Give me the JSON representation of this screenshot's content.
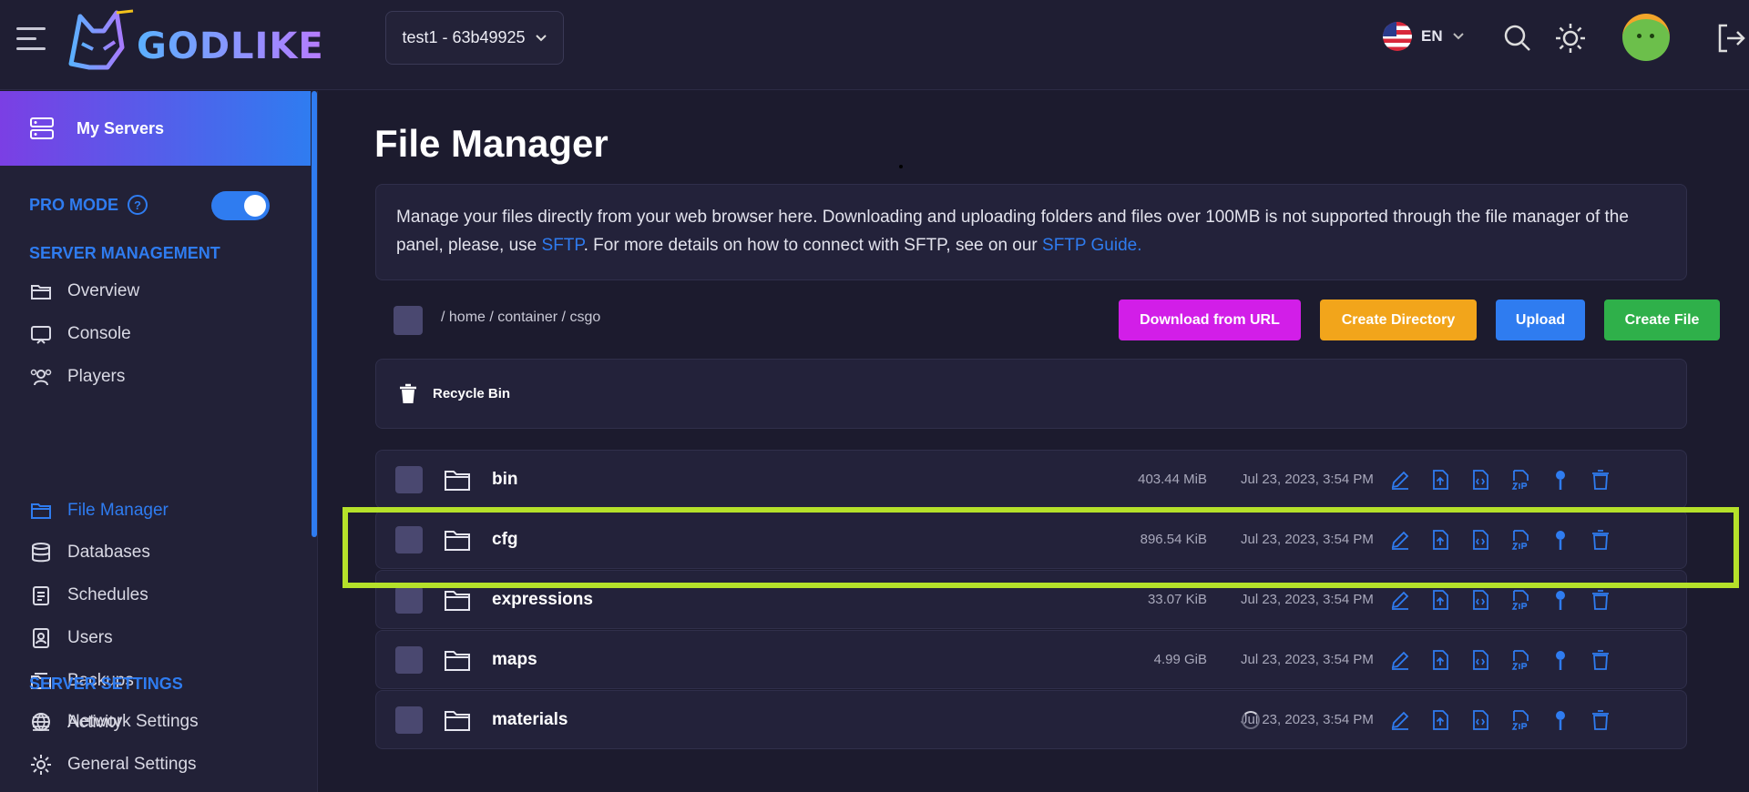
{
  "header": {
    "logo_text": "GODLIKE",
    "server_selector": "test1 - 63b49925",
    "language": "EN"
  },
  "sidebar": {
    "my_servers": "My Servers",
    "pro_mode_label": "PRO MODE",
    "pro_mode_enabled": true,
    "help_glyph": "?",
    "section_management": "SERVER MANAGEMENT",
    "management_items": [
      {
        "label": "Overview",
        "icon": "folder-open-icon"
      },
      {
        "label": "Console",
        "icon": "console-icon"
      },
      {
        "label": "Players",
        "icon": "players-icon"
      },
      {
        "label": "File Manager",
        "icon": "folder-icon",
        "active": true
      },
      {
        "label": "Databases",
        "icon": "database-icon"
      },
      {
        "label": "Schedules",
        "icon": "clipboard-icon"
      },
      {
        "label": "Users",
        "icon": "user-badge-icon"
      },
      {
        "label": "Backups",
        "icon": "backup-icon"
      },
      {
        "label": "Activity",
        "icon": "list-icon"
      }
    ],
    "section_settings": "SERVER SETTINGS",
    "settings_items": [
      {
        "label": "Network Settings",
        "icon": "globe-icon"
      },
      {
        "label": "General Settings",
        "icon": "gear-icon"
      }
    ]
  },
  "main": {
    "title": "File Manager",
    "info": {
      "text_1": "Manage your files directly from your web browser here. Downloading and uploading folders and files over 100MB is not supported through the file manager of the panel, please, use ",
      "link_sftp": "SFTP",
      "text_2": ". For more details on how to connect with SFTP, see on our ",
      "link_guide": "SFTP Guide."
    },
    "breadcrumb": [
      "/ home",
      "/ container",
      "/ csgo"
    ],
    "buttons": {
      "download_url": "Download from URL",
      "create_directory": "Create Directory",
      "upload": "Upload",
      "create_file": "Create File"
    },
    "recycle_bin": "Recycle Bin",
    "files": [
      {
        "name": "bin",
        "size": "403.44 MiB",
        "date": "Jul 23, 2023, 3:54 PM"
      },
      {
        "name": "cfg",
        "size": "896.54 KiB",
        "date": "Jul 23, 2023, 3:54 PM"
      },
      {
        "name": "expressions",
        "size": "33.07 KiB",
        "date": "Jul 23, 2023, 3:54 PM"
      },
      {
        "name": "maps",
        "size": "4.99 GiB",
        "date": "Jul 23, 2023, 3:54 PM"
      },
      {
        "name": "materials",
        "size": "",
        "date": "Jul 23, 2023, 3:54 PM"
      }
    ],
    "row_actions": [
      "edit-icon",
      "upload-file-icon",
      "code-file-icon",
      "zip-icon",
      "pin-icon",
      "trash-icon"
    ]
  },
  "colors": {
    "accent_blue": "#2f7cf0",
    "download_button": "#d21ee8",
    "create_directory_button": "#f2a51b",
    "upload_button": "#2f7cf0",
    "create_file_button": "#2fb04a",
    "highlight": "#b5e12a"
  }
}
